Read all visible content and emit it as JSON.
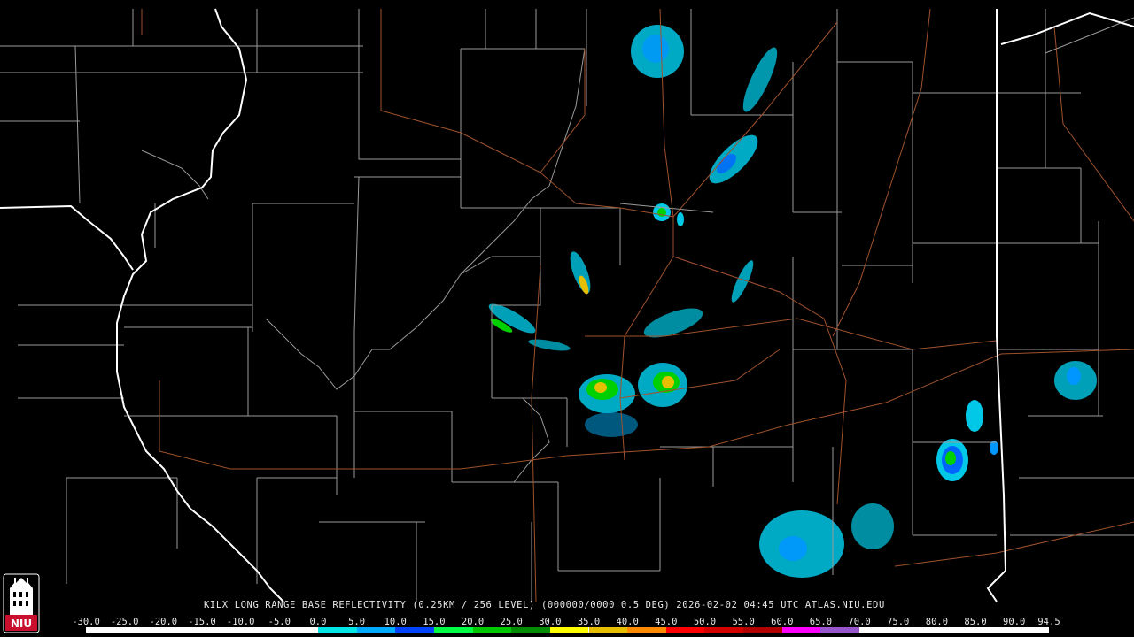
{
  "caption": {
    "radar": "KILX",
    "product": "LONG RANGE BASE REFLECTIVITY",
    "resolution": "(0.25KM / 256 LEVEL)",
    "volume": "(000000/0000 0.5 DEG)",
    "date": "2026-02-02",
    "time": "04:45",
    "timezone": "UTC",
    "site": "ATLAS.NIU.EDU"
  },
  "logo": {
    "text": "NIU",
    "color": "#c8102e"
  },
  "scale": {
    "labels": [
      "-30.0",
      "-25.0",
      "-20.0",
      "-15.0",
      "-10.0",
      "-5.0",
      "0.0",
      "5.0",
      "10.0",
      "15.0",
      "20.0",
      "25.0",
      "30.0",
      "35.0",
      "40.0",
      "45.0",
      "50.0",
      "55.0",
      "60.0",
      "65.0",
      "70.0",
      "75.0",
      "80.0",
      "85.0",
      "90.0",
      "94.5"
    ],
    "min": -30,
    "max": 94.5,
    "colors": [
      {
        "from": -30,
        "to": 0,
        "color": "#ffffff"
      },
      {
        "from": 0,
        "to": 5,
        "color": "#00e6e6"
      },
      {
        "from": 5,
        "to": 10,
        "color": "#00aaff"
      },
      {
        "from": 10,
        "to": 15,
        "color": "#0044ff"
      },
      {
        "from": 15,
        "to": 20,
        "color": "#00ff44"
      },
      {
        "from": 20,
        "to": 25,
        "color": "#00c800"
      },
      {
        "from": 25,
        "to": 30,
        "color": "#008c00"
      },
      {
        "from": 30,
        "to": 35,
        "color": "#ffff00"
      },
      {
        "from": 35,
        "to": 40,
        "color": "#e6c000"
      },
      {
        "from": 40,
        "to": 45,
        "color": "#ff8c00"
      },
      {
        "from": 45,
        "to": 50,
        "color": "#ff0000"
      },
      {
        "from": 50,
        "to": 55,
        "color": "#d40000"
      },
      {
        "from": 55,
        "to": 60,
        "color": "#b00000"
      },
      {
        "from": 60,
        "to": 65,
        "color": "#ff00ff"
      },
      {
        "from": 65,
        "to": 70,
        "color": "#9955cc"
      },
      {
        "from": 70,
        "to": 80,
        "color": "#ffffff"
      },
      {
        "from": 80,
        "to": 94.5,
        "color": "#ffffff"
      }
    ]
  },
  "map_colors": {
    "background": "#000000",
    "county_lines": "#9a9a9a",
    "state_lines": "#ffffff",
    "highways": "#a0522d"
  }
}
